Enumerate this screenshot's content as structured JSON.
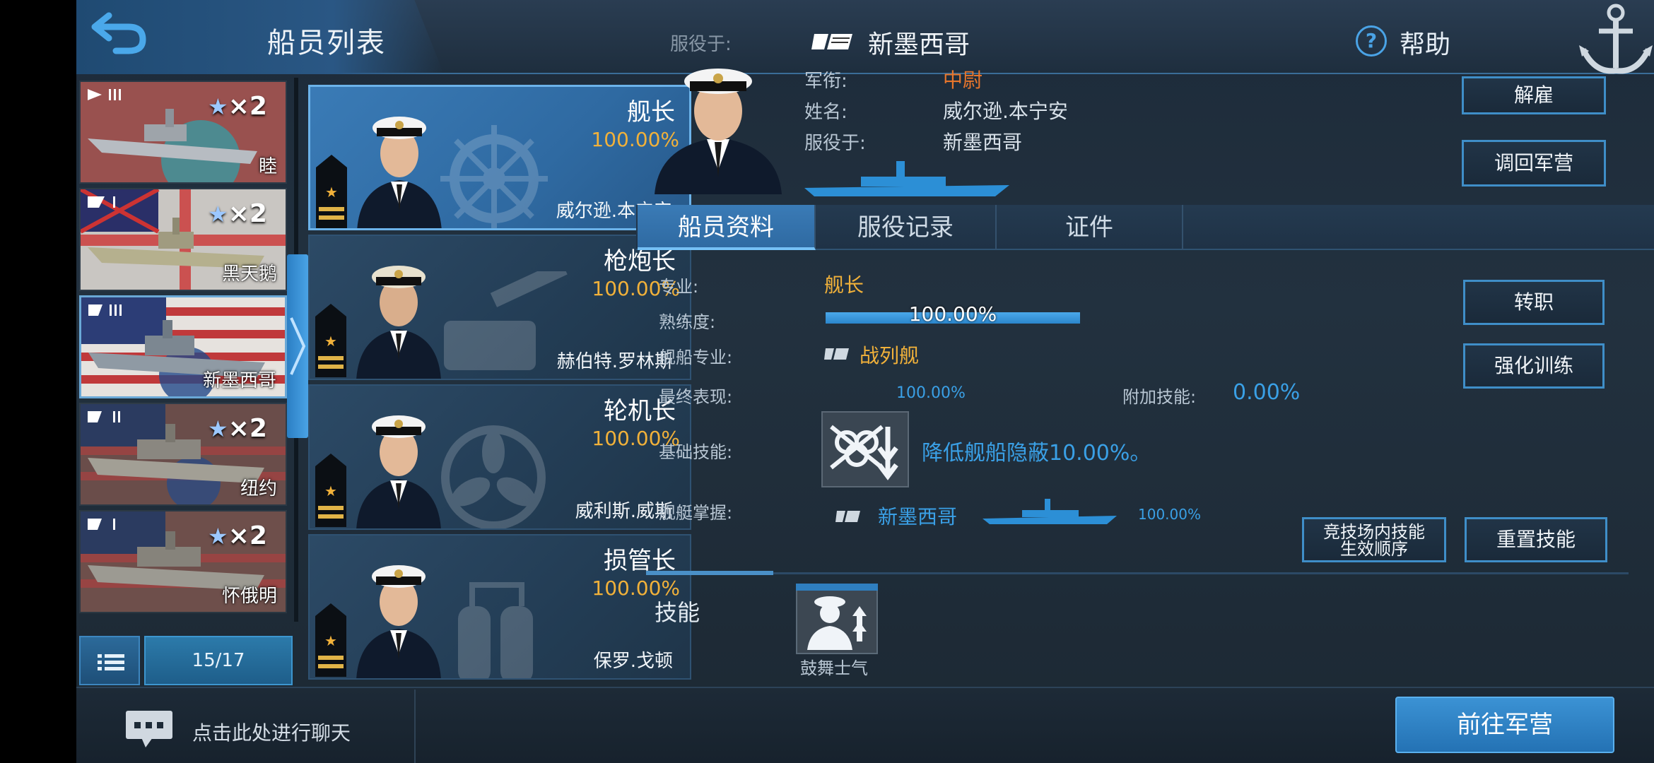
{
  "header": {
    "title": "船员列表",
    "serving_label": "服役于:",
    "serving_ship": "新墨西哥",
    "help_label": "帮助"
  },
  "ships": [
    {
      "name": "睦",
      "stars": "×2",
      "flag": "japan"
    },
    {
      "name": "黑天鹅",
      "stars": "×2",
      "flag": "uk"
    },
    {
      "name": "新墨西哥",
      "stars": "",
      "flag": "usa",
      "selected": true
    },
    {
      "name": "纽约",
      "stars": "×2",
      "flag": "usa"
    },
    {
      "name": "怀俄明",
      "stars": "×2",
      "flag": "usa"
    }
  ],
  "page_count": "15/17",
  "crew": [
    {
      "role": "舰长",
      "pct": "100.00%",
      "name": "威尔逊.本宁安",
      "selected": true,
      "icon": "helm-wheel-icon"
    },
    {
      "role": "枪炮长",
      "pct": "100.00%",
      "name": "赫伯特.罗林斯",
      "icon": "gun-turret-icon"
    },
    {
      "role": "轮机长",
      "pct": "100.00%",
      "name": "威利斯.威斯",
      "icon": "propeller-icon"
    },
    {
      "role": "损管长",
      "pct": "100.00%",
      "name": "保罗.戈顿",
      "icon": "fire-extinguisher-icon"
    }
  ],
  "detail": {
    "rank_label": "军衔:",
    "rank_value": "中尉",
    "name_label": "姓名:",
    "name_value": "威尔逊.本宁安",
    "serving_label": "服役于:",
    "serving_value": "新墨西哥",
    "dismiss": "解雇",
    "recall": "调回军营"
  },
  "tabs": [
    "船员资料",
    "服役记录",
    "证件"
  ],
  "profile": {
    "specialty_label": "专业:",
    "specialty_value": "舰长",
    "proficiency_label": "熟练度:",
    "proficiency_value": "100.00%",
    "proficiency_fraction": 1.0,
    "ship_specialty_label": "舰船专业:",
    "ship_specialty_value": "战列舰",
    "performance_label": "最终表现:",
    "performance_value": "100.00%",
    "extra_skill_label": "附加技能:",
    "extra_skill_value": "0.00%",
    "base_skill_label": "基础技能:",
    "base_skill_value": "降低舰船隐蔽10.00%。",
    "mastery_label": "舰艇掌握:",
    "mastery_ship": "新墨西哥",
    "mastery_value": "100.00%",
    "transfer": "转职",
    "train": "强化训练",
    "arena_line1": "竞技场内技能",
    "arena_line2": "生效顺序",
    "reset": "重置技能"
  },
  "skills": {
    "label": "技能",
    "items": [
      {
        "name": "鼓舞士气"
      }
    ]
  },
  "bottom": {
    "chat_label": "点击此处进行聊天",
    "goto_barracks": "前往军营"
  },
  "colors": {
    "accent": "#3aa0e6",
    "gold": "#f1b13a",
    "rank": "#e8762c"
  }
}
